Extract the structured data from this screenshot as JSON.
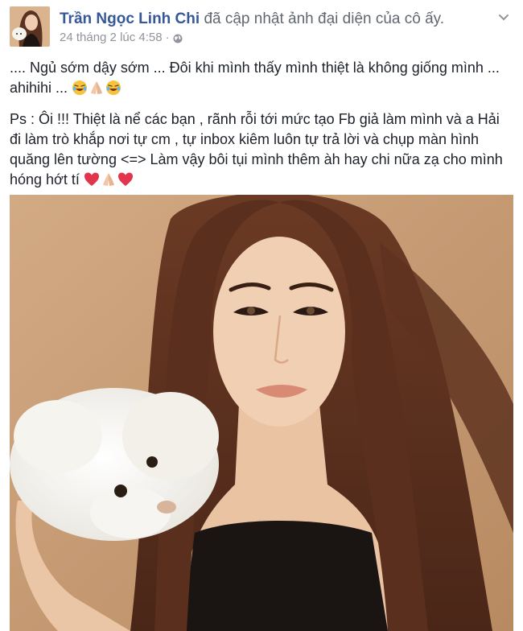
{
  "post": {
    "author": "Trần Ngọc Linh Chi",
    "action": "đã cập nhật ảnh đại diện của cô ấy.",
    "timestamp": "24 tháng 2 lúc 4:58",
    "separator": "·",
    "privacy_icon": "globe-icon",
    "menu_icon": "chevron-down-icon",
    "paragraph1": ".... Ngủ sớm dậy sớm ... Đôi khi mình thấy mình thiệt là không giống mình ... ahihihi ...",
    "paragraph2": "Ps : Ôi !!! Thiệt là nể các bạn , rãnh rỗi tới mức tạo Fb giả làm mình và a Hải đi làm trò khắp nơi tự cm , tự inbox kiêm luôn tự trả lời và chụp màn hình quăng lên tường <=> Làm vậy bôi tụi mình thêm àh hay chi nữa zạ cho mình hóng hớt tí",
    "paragraph1_emojis": [
      "laughing-tears-emoji",
      "praying-hands-emoji",
      "laughing-tears-emoji"
    ],
    "paragraph2_emojis": [
      "red-heart-emoji",
      "praying-hands-emoji",
      "red-heart-emoji"
    ],
    "colors": {
      "author": "#365899",
      "meta": "#90949c",
      "text": "#1d2129",
      "photo_bg": "#c9a078"
    }
  }
}
